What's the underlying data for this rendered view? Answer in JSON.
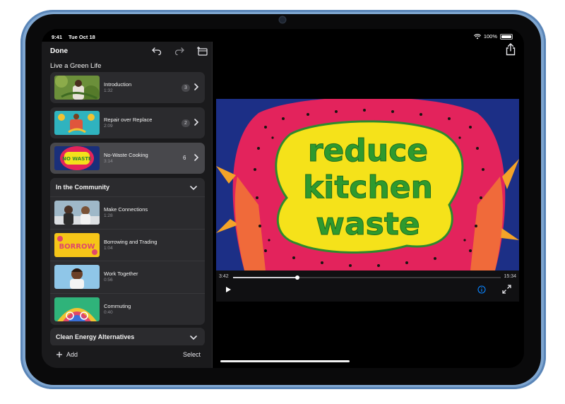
{
  "status_bar": {
    "time": "9:41",
    "date": "Tue Oct 18",
    "battery": "100%"
  },
  "sidebar": {
    "done_label": "Done",
    "project_title": "Live a Green Life",
    "clips": [
      {
        "title": "Introduction",
        "duration": "1:32",
        "count": "3"
      },
      {
        "title": "Repair over Replace",
        "duration": "2:09",
        "count": "2"
      },
      {
        "title": "No-Waste Cooking",
        "duration": "3:14",
        "count": "6"
      }
    ],
    "section_community": {
      "title": "In the Community",
      "items": [
        {
          "title": "Make Connections",
          "duration": "1:28"
        },
        {
          "title": "Borrowing and Trading",
          "duration": "1:04"
        },
        {
          "title": "Work Together",
          "duration": "0:56"
        },
        {
          "title": "Commuting",
          "duration": "0:40"
        }
      ]
    },
    "section_energy": {
      "title": "Clean Energy Alternatives"
    },
    "add_label": "Add",
    "select_label": "Select"
  },
  "player": {
    "video_text": [
      "reduce",
      "kitchen",
      "waste"
    ],
    "time_elapsed": "3:42",
    "time_total": "15:34",
    "progress": 0.24
  },
  "thumb_texts": {
    "borrow": "BORROW",
    "no_waste": "NO WASTE"
  },
  "colors": {
    "accent": "#0a84ff",
    "sidebar_bg": "#1a1a1c",
    "card_bg": "#2b2b2e",
    "selected_bg": "#48484c"
  }
}
